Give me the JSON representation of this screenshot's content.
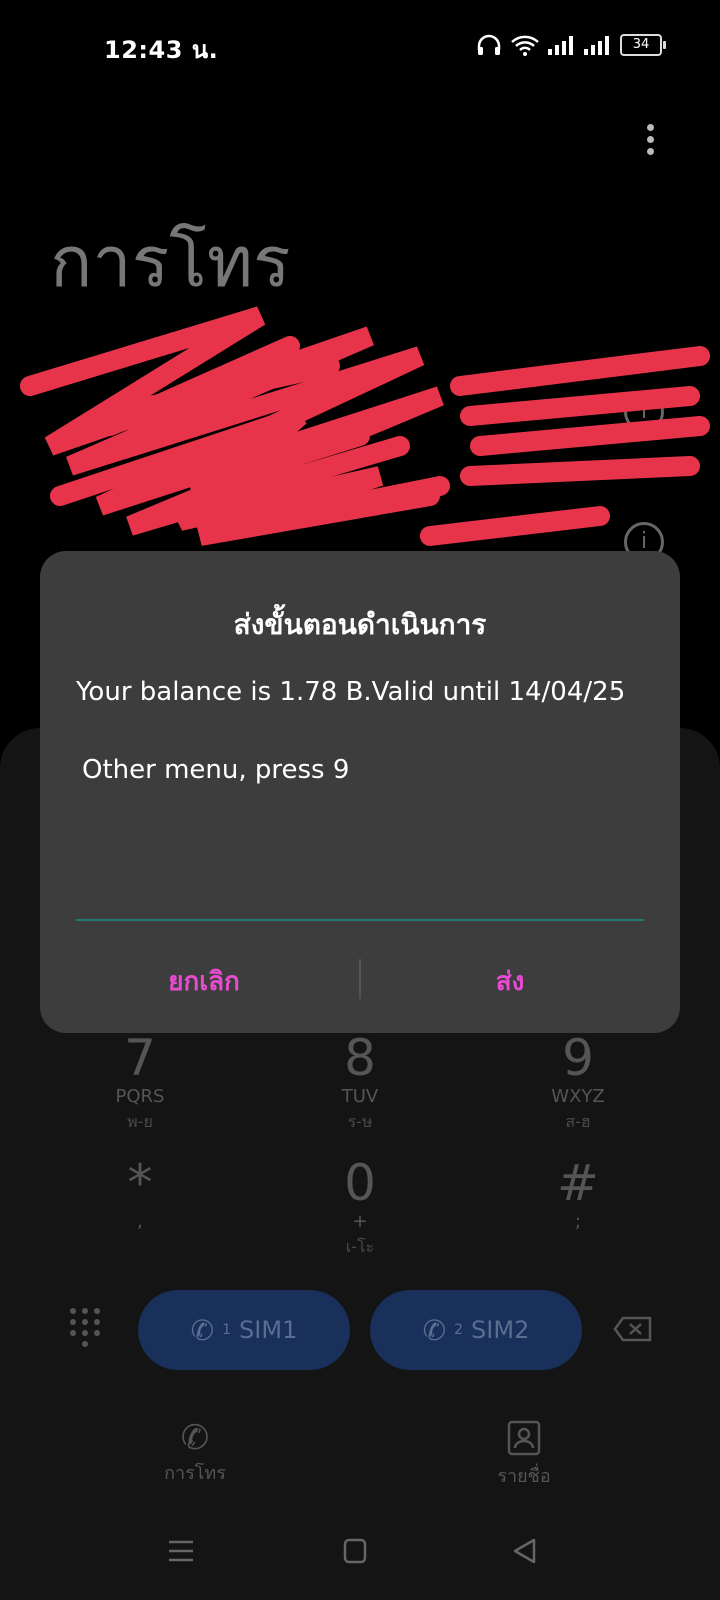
{
  "status_bar": {
    "time": "12:43 น.",
    "battery": "34"
  },
  "header": {
    "title": "การโทร"
  },
  "dialpad": {
    "keys": [
      {
        "digit": "7",
        "letters": "PQRS",
        "thai": "พ-ย"
      },
      {
        "digit": "8",
        "letters": "TUV",
        "thai": "ร-ษ"
      },
      {
        "digit": "9",
        "letters": "WXYZ",
        "thai": "ส-ฮ"
      },
      {
        "digit": "*",
        "letters": ",",
        "thai": ""
      },
      {
        "digit": "0",
        "letters": "+",
        "thai": "เ-โะ"
      },
      {
        "digit": "#",
        "letters": ";",
        "thai": ""
      }
    ],
    "sim1_label": "SIM1",
    "sim2_label": "SIM2",
    "sim1_sup": "1",
    "sim2_sup": "2"
  },
  "tabs": {
    "calls": "การโทร",
    "contacts": "รายชื่อ"
  },
  "dialog": {
    "title": "ส่งขั้นตอนดำเนินการ",
    "message_line1": "Your balance is 1.78 B.Valid until 14/04/25",
    "message_line2": "Other menu, press 9",
    "input_value": "",
    "cancel_label": "ยกเลิก",
    "send_label": "ส่ง"
  },
  "colors": {
    "accent": "#e64bd0",
    "sim_button": "#18305a",
    "dialog_bg": "#3d3d3d",
    "scribble": "#e8344a"
  }
}
